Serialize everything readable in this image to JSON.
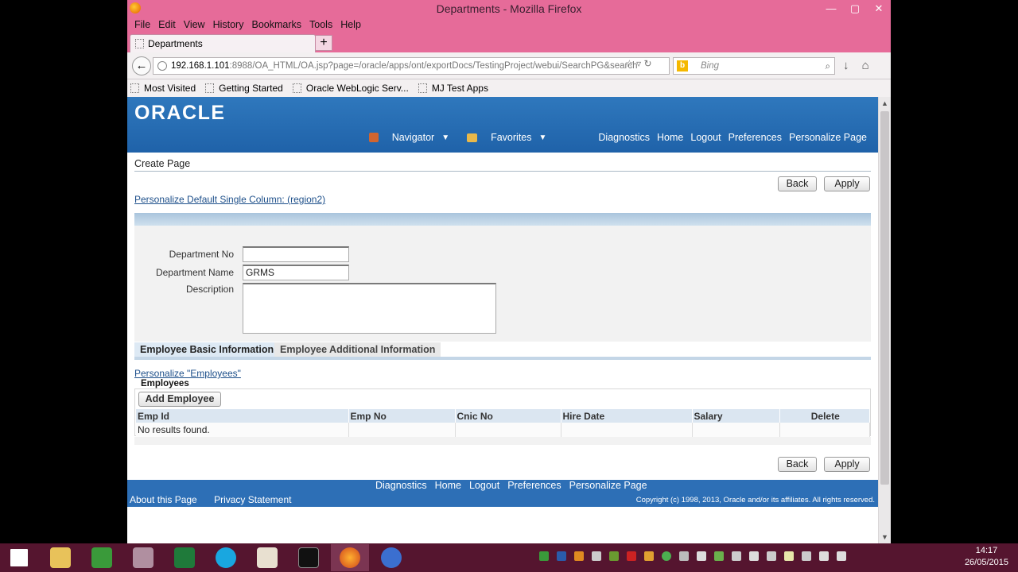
{
  "window": {
    "title": "Departments - Mozilla Firefox",
    "min": "—",
    "max": "▢",
    "close": "✕"
  },
  "menu": [
    "File",
    "Edit",
    "View",
    "History",
    "Bookmarks",
    "Tools",
    "Help"
  ],
  "tab": {
    "label": "Departments",
    "new_tab": "+"
  },
  "url": {
    "host": "192.168.1.101",
    "rest": ":8988/OA_HTML/OA.jsp?page=/oracle/apps/ont/exportDocs/TestingProject/webui/SearchPG&search"
  },
  "search": {
    "placeholder": "Bing",
    "engine": "b"
  },
  "bookmarks": [
    "Most Visited",
    "Getting Started",
    "Oracle WebLogic Serv...",
    "MJ Test Apps"
  ],
  "brand": {
    "logo": "ORACLE",
    "navigator": "Navigator",
    "favorites": "Favorites",
    "links": [
      "Diagnostics",
      "Home",
      "Logout",
      "Preferences",
      "Personalize Page"
    ]
  },
  "page": {
    "title": "Create Page",
    "back": "Back",
    "apply": "Apply",
    "personalize_region": "Personalize Default Single Column: (region2)",
    "fields": {
      "dept_no_label": "Department No",
      "dept_no_value": "",
      "dept_name_label": "Department Name",
      "dept_name_value": "GRMS",
      "description_label": "Description",
      "description_value": ""
    },
    "tabs": [
      "Employee Basic Information",
      "Employee Additional Information"
    ],
    "personalize_employees": "Personalize \"Employees\"",
    "employees_header": "Employees",
    "add_employee": "Add Employee",
    "columns": [
      "Emp Id",
      "Emp No",
      "Cnic No",
      "Hire Date",
      "Salary",
      "Delete"
    ],
    "no_results": "No results found."
  },
  "footer": {
    "links": [
      "Diagnostics",
      "Home",
      "Logout",
      "Preferences",
      "Personalize Page"
    ],
    "about": "About this Page",
    "privacy": "Privacy Statement",
    "copyright": "Copyright (c) 1998, 2013, Oracle and/or its affiliates. All rights reserved."
  },
  "clock": {
    "time": "14:17",
    "date": "26/05/2015"
  },
  "colors": {
    "titlebar": "#e66b99",
    "oracle_blue": "#1f62a9",
    "taskbar": "#55152f"
  }
}
